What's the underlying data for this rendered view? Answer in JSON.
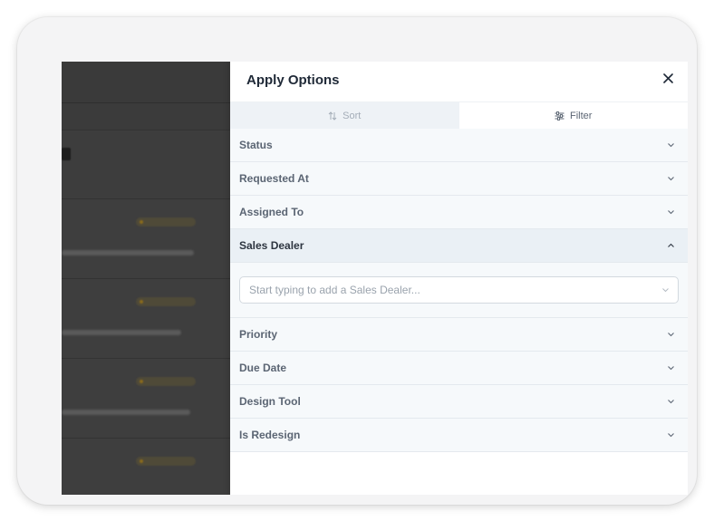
{
  "panel": {
    "title": "Apply Options",
    "close_icon": "close-icon"
  },
  "tabs": [
    {
      "label": "Sort",
      "icon": "sort-arrows-icon",
      "active": false
    },
    {
      "label": "Filter",
      "icon": "sliders-icon",
      "active": true
    }
  ],
  "sections": [
    {
      "label": "Status",
      "expanded": false
    },
    {
      "label": "Requested At",
      "expanded": false
    },
    {
      "label": "Assigned To",
      "expanded": false
    },
    {
      "label": "Sales Dealer",
      "expanded": true
    },
    {
      "label": "Priority",
      "expanded": false
    },
    {
      "label": "Due Date",
      "expanded": false
    },
    {
      "label": "Design Tool",
      "expanded": false
    },
    {
      "label": "Is Redesign",
      "expanded": false
    }
  ],
  "sales_dealer": {
    "value": "",
    "placeholder": "Start typing to add a Sales Dealer..."
  },
  "colors": {
    "accent_text": "#1f2937",
    "section_bg": "#f6f9fb",
    "open_section_bg": "#eaf0f5",
    "backdrop": "#3d3d3d"
  }
}
